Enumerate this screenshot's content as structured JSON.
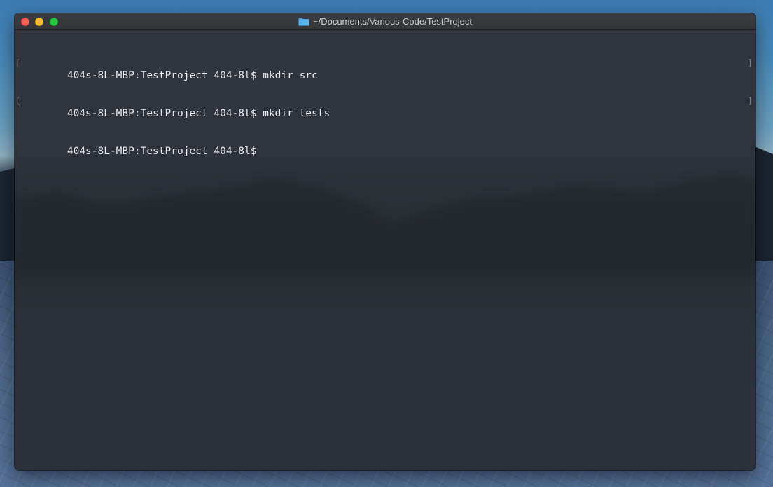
{
  "window": {
    "title": "~/Documents/Various-Code/TestProject",
    "title_icon": "folder-icon",
    "title_icon_color": "#4da6e0"
  },
  "traffic_lights": {
    "close_color": "#fe5f57",
    "minimize_color": "#febc2e",
    "zoom_color": "#28c840"
  },
  "terminal": {
    "lines": [
      {
        "prompt": "404s-8L-MBP:TestProject 404-8l$",
        "command": "mkdir src",
        "marked": true
      },
      {
        "prompt": "404s-8L-MBP:TestProject 404-8l$",
        "command": "mkdir tests",
        "marked": true
      },
      {
        "prompt": "404s-8L-MBP:TestProject 404-8l$",
        "command": "",
        "marked": false
      }
    ],
    "mark_open": "[",
    "mark_close": "]"
  }
}
